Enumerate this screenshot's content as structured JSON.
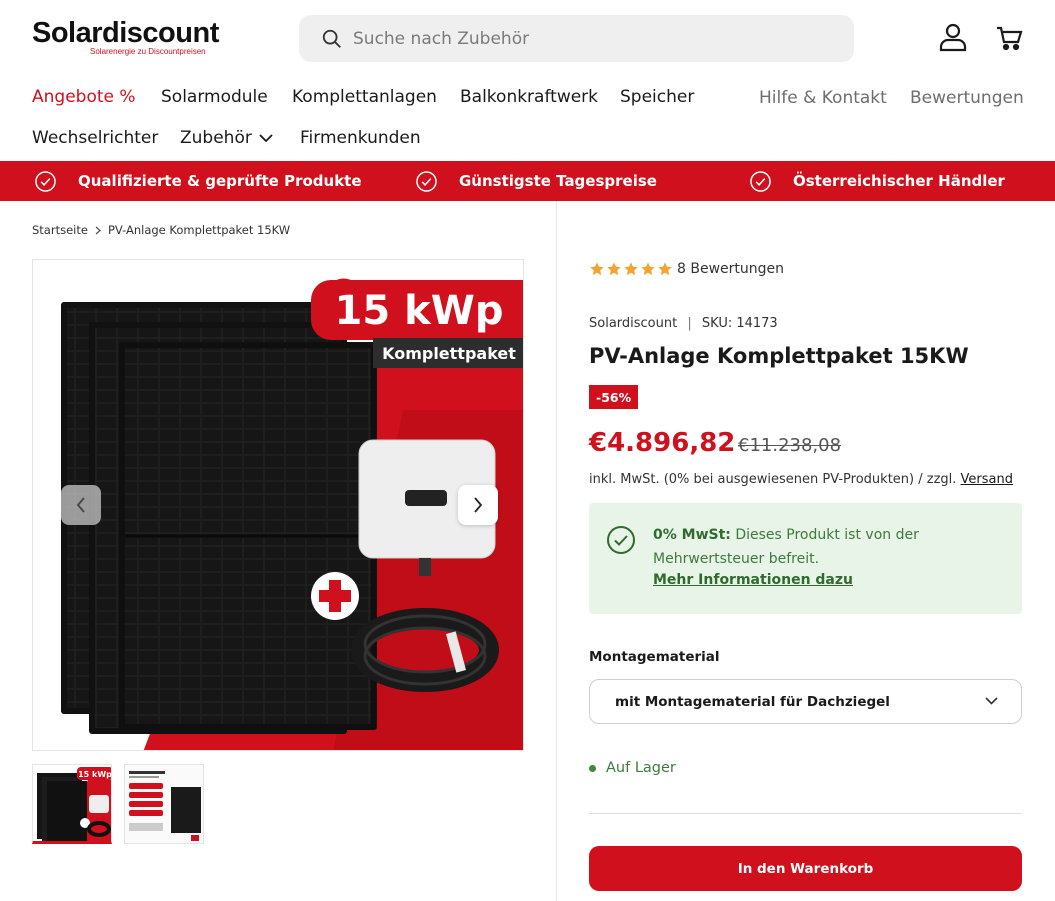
{
  "header": {
    "brand": "Solardiscount",
    "tagline": "Solarenergie zu Discountpreisen",
    "search_placeholder": "Suche nach Zubehör",
    "icons": [
      "account-icon",
      "cart-icon"
    ]
  },
  "nav": {
    "items": [
      "Angebote %",
      "Solarmodule",
      "Komplettanlagen",
      "Balkonkraftwerk",
      "Speicher",
      "Wechselrichter",
      "Zubehör",
      "Firmenkunden"
    ],
    "secondary": [
      "Hilfe & Kontakt",
      "Bewertungen"
    ]
  },
  "usp": [
    "Qualifizierte & geprüfte Produkte",
    "Günstigste Tagespreise",
    "Österreichischer Händler"
  ],
  "breadcrumb": [
    "Startseite",
    "PV-Anlage Komplettpaket 15KW"
  ],
  "gallery": {
    "badge_power": "15 kWp",
    "badge_label": "Komplettpaket",
    "thumb_badge": "15 kWp"
  },
  "product": {
    "rating_stars": 5,
    "reviews": "8 Bewertungen",
    "vendor": "Solardiscount",
    "sku": "SKU: 14173",
    "title": "PV-Anlage Komplettpaket 15KW",
    "discount": "-56%",
    "price": "€4.896,82",
    "old_price": "€11.238,08",
    "tax_text": "inkl. MwSt. (0% bei ausgewiesenen PV-Produkten) / zzgl.",
    "shipping_link": "Versand",
    "vat_title": "0% MwSt:",
    "vat_text": "Dieses Produkt ist von der Mehrwertsteuer befreit.",
    "vat_link": "Mehr Informationen dazu",
    "option_label": "Montagematerial",
    "option_value": "mit Montagematerial für Dachziegel",
    "stock": "Auf Lager",
    "cart_button": "In den Warenkorb"
  },
  "colors": {
    "accent": "#d0101c",
    "success_bg": "#e8f4e8",
    "success_text": "#2f6b2f",
    "star": "#f0a533"
  }
}
